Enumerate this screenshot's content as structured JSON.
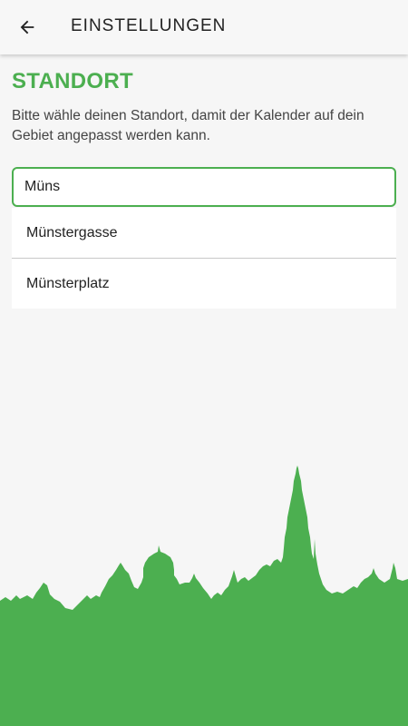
{
  "appbar": {
    "title": "EINSTELLUNGEN",
    "back_icon": "arrow-left-icon"
  },
  "section": {
    "title": "STANDORT",
    "description": "Bitte wähle deinen Standort, damit der Kalender auf dein Gebiet angepasst werden kann."
  },
  "search": {
    "value": "Müns"
  },
  "suggestions": [
    {
      "label": "Münstergasse"
    },
    {
      "label": "Münsterplatz"
    }
  ],
  "colors": {
    "accent": "#4caf50",
    "background": "#f6f6f6"
  },
  "decoration": {
    "skyline_icon": "city-skyline-silhouette"
  }
}
